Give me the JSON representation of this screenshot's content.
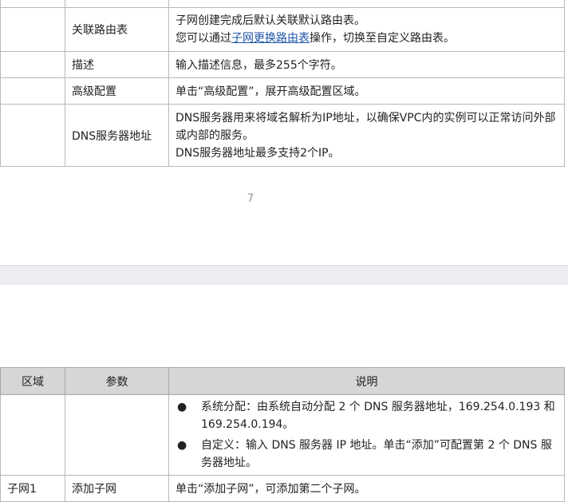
{
  "top_table": {
    "rows": [
      {
        "param": "关联路由表",
        "desc_line1": "子网创建完成后默认关联默认路由表。",
        "desc_line2_prefix": "您可以通过",
        "desc_line2_link": "子网更换路由表",
        "desc_line2_suffix": "操作，切换至自定义路由表。"
      },
      {
        "param": "描述",
        "desc": "输入描述信息，最多255个字符。"
      },
      {
        "param": "高级配置",
        "desc": "单击“高级配置”，展开高级配置区域。"
      },
      {
        "param": "DNS服务器地址",
        "desc_line1": "DNS服务器用来将域名解析为IP地址，以确保VPC内的实例可以正常访问外部或内部的服务。",
        "desc_line2": "DNS服务器地址最多支持2个IP。"
      }
    ]
  },
  "page_number": "7",
  "bottom_table": {
    "headers": {
      "region": "区域",
      "param": "参数",
      "desc": "说明"
    },
    "bullet_row": {
      "bullets": [
        "系统分配：由系统自动分配 2 个 DNS 服务器地址，169.254.0.193 和 169.254.0.194。",
        "自定义：输入 DNS 服务器 IP 地址。单击“添加”可配置第 2 个 DNS 服务器地址。"
      ]
    },
    "subnet_row": {
      "region": "子网1",
      "param": "添加子网",
      "desc": "单击“添加子网”，可添加第二个子网。"
    }
  }
}
